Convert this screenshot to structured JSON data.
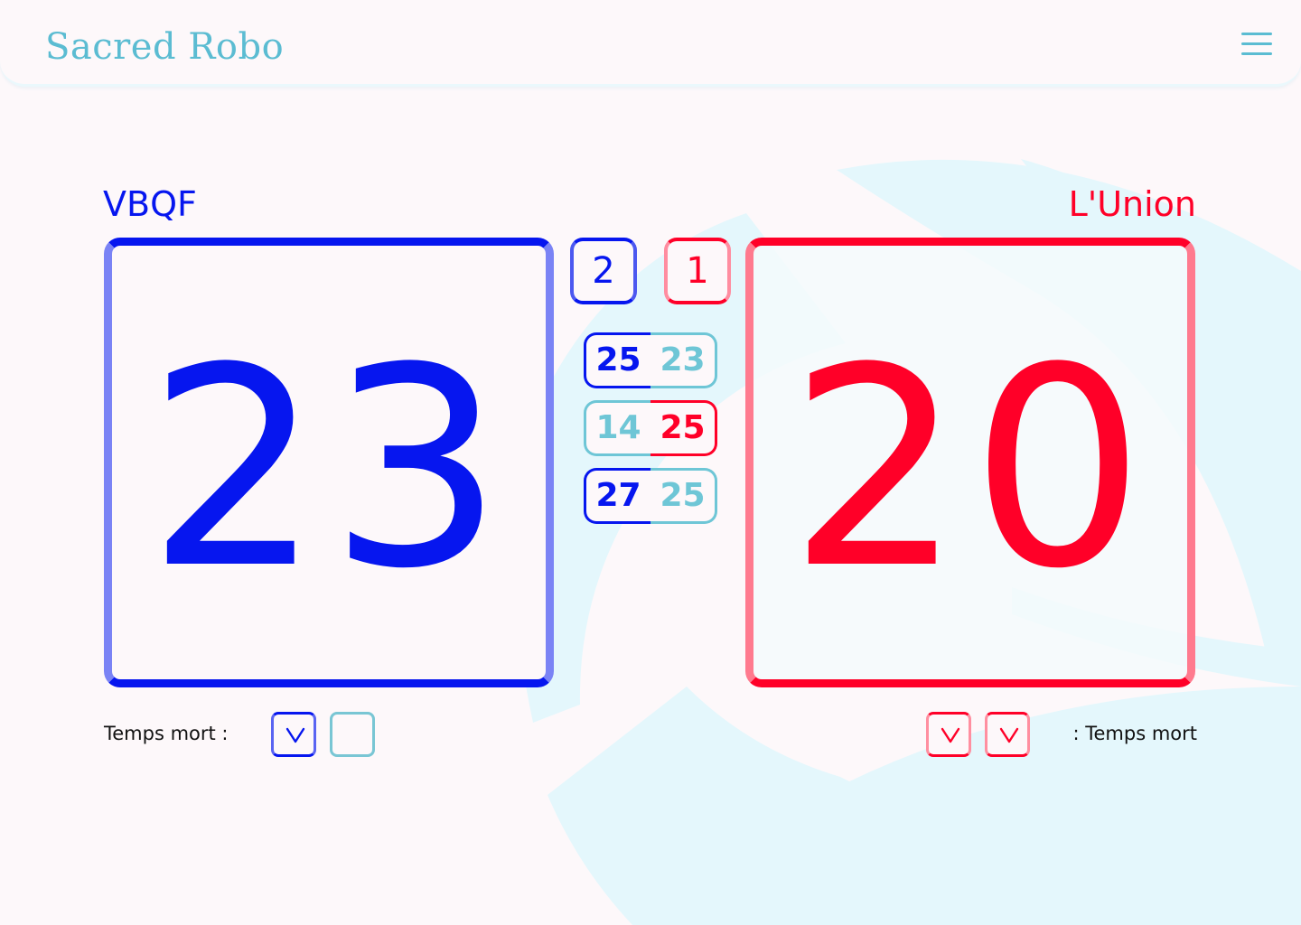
{
  "app": {
    "brand": "Sacred Robo",
    "menu_icon": "hamburger-menu-icon"
  },
  "colors": {
    "home": "#0616ef",
    "away": "#ff0028",
    "accent": "#5bbcd2",
    "inactive": "#6ec6d6",
    "background": "#fdf8fa"
  },
  "match": {
    "home": {
      "name": "VBQF",
      "score": "23",
      "sets_won": "2",
      "timeout_label": "Temps mort :",
      "timeouts_used": 1,
      "timeouts_total": 2
    },
    "away": {
      "name": "L'Union",
      "score": "20",
      "sets_won": "1",
      "timeout_label": ": Temps mort",
      "timeouts_used": 2,
      "timeouts_total": 2
    },
    "sets": [
      {
        "home": "25",
        "away": "23",
        "winner": "home"
      },
      {
        "home": "14",
        "away": "25",
        "winner": "away"
      },
      {
        "home": "27",
        "away": "25",
        "winner": "home"
      }
    ]
  },
  "icons": {
    "timeout_used": "chevron-down-icon"
  }
}
